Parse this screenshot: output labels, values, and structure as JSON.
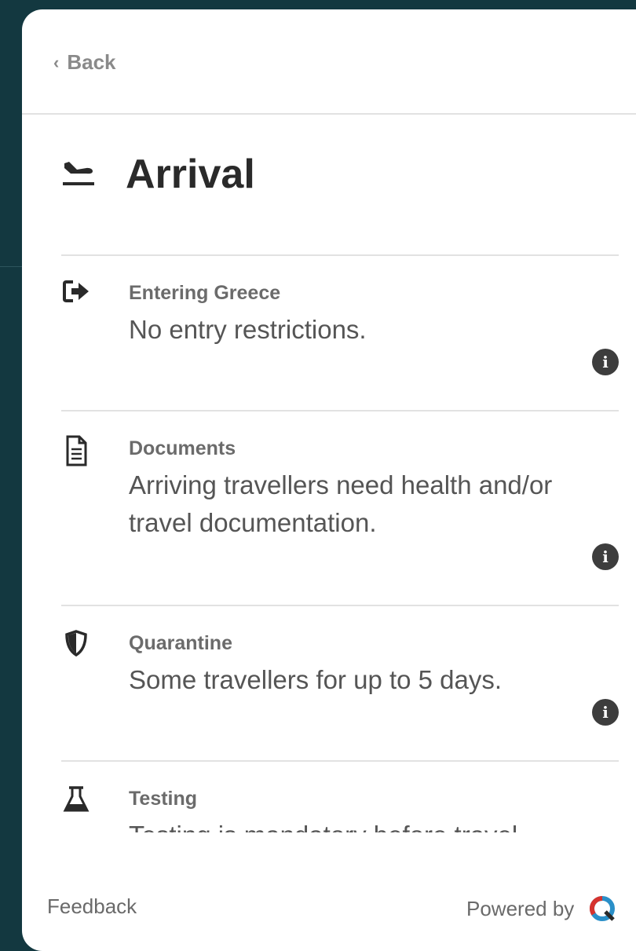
{
  "header": {
    "back_label": "Back"
  },
  "page": {
    "title": "Arrival"
  },
  "sections": [
    {
      "label": "Entering Greece",
      "description": "No entry restrictions.",
      "icon": "entry-icon"
    },
    {
      "label": "Documents",
      "description": "Arriving travellers need health and/or travel documentation.",
      "icon": "document-icon"
    },
    {
      "label": "Quarantine",
      "description": "Some travellers for up to 5 days.",
      "icon": "shield-icon"
    },
    {
      "label": "Testing",
      "description": "Testing is mandatory before travel",
      "icon": "flask-icon"
    }
  ],
  "footer": {
    "feedback_label": "Feedback",
    "powered_by_label": "Powered by"
  },
  "colors": {
    "background": "#133840",
    "panel": "#ffffff",
    "info_badge": "#3d3d3d",
    "brand_red": "#d6332e",
    "brand_blue": "#2a8fc8"
  }
}
